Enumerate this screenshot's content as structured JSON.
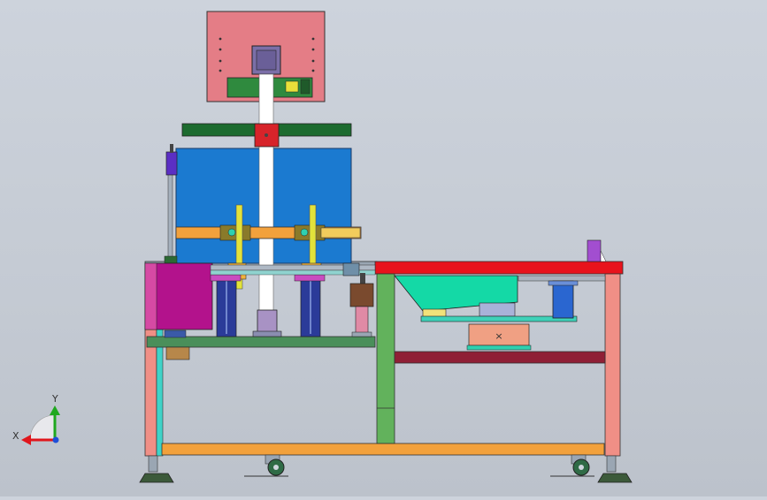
{
  "triad": {
    "x_label": "X",
    "y_label": "Y"
  },
  "colors": {
    "background": "#c8ced7",
    "frame_red": "#e8131c",
    "frame_salmon": "#f08f86",
    "frame_green": "#62b25c",
    "frame_orange": "#f2a13c",
    "tank_blue": "#1b7ad0",
    "panel_pink": "#e47d86",
    "beam_green": "#1c6b2f",
    "magenta_box": "#b3128c",
    "cyan_hopper": "#14d9a6",
    "maroon_bar": "#8f1f35",
    "column_white": "#ffffff",
    "rail_yellow": "#e2e23a"
  }
}
